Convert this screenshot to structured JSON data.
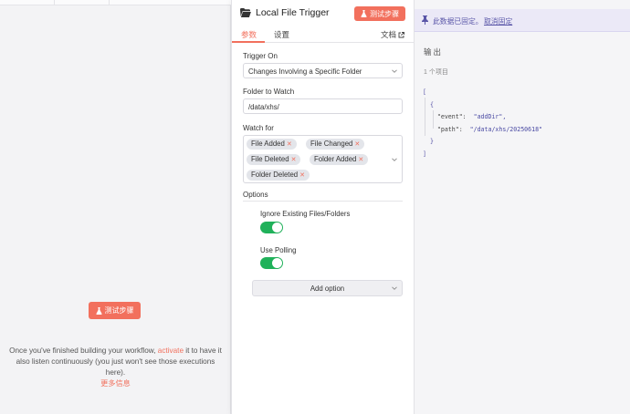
{
  "left": {
    "test_button": "测试步骤",
    "msg_before": "Once you've finished building your workflow,",
    "msg_link": "activate",
    "msg_after": "it to have it also listen continuously (you just won't see those executions here).",
    "more_info": "更多信息"
  },
  "node": {
    "title": "Local File Trigger",
    "test_button": "测试步骤",
    "tabs": {
      "params": "参数",
      "settings": "设置",
      "docs": "文档"
    },
    "trigger_on": {
      "label": "Trigger On",
      "value": "Changes Involving a Specific Folder"
    },
    "folder": {
      "label": "Folder to Watch",
      "value": "/data/xhs/"
    },
    "watch_for": {
      "label": "Watch for",
      "chips": [
        "File Added",
        "File Changed",
        "File Deleted",
        "Folder Added",
        "Folder Deleted"
      ]
    },
    "options": {
      "label": "Options",
      "ignore_existing": "Ignore Existing Files/Folders",
      "use_polling": "Use Polling",
      "add_option": "Add option"
    }
  },
  "output": {
    "pinned_text": "此数据已固定。",
    "unpin": "取消固定",
    "title": "输出",
    "count": "1 个项目",
    "json": {
      "open_bracket": "[",
      "open_brace": "{",
      "event_key": "\"event\":",
      "event_val": "\"addDir\",",
      "path_key": "\"path\":",
      "path_val": "\"/data/xhs/20250618\"",
      "close_brace": "}",
      "close_bracket": "]"
    }
  },
  "colors": {
    "accent": "#f2705d",
    "toggle_on": "#20b15a",
    "pinned_bg": "#ebe9f7"
  }
}
